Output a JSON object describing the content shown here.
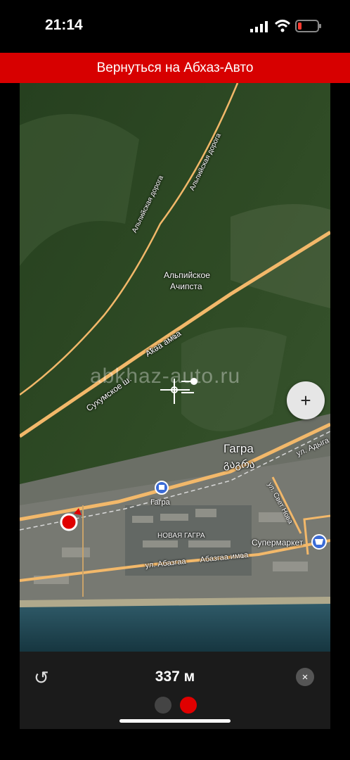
{
  "status_bar": {
    "time": "21:14"
  },
  "banner": {
    "label": "Вернуться на Абхаз-Авто"
  },
  "map": {
    "watermark": "abkhaz-auto.ru",
    "labels": {
      "alpine_road_1": "Альпийская дорога",
      "alpine_road_2": "Альпийская дорога",
      "alpiyskoe": "Альпийское",
      "achipsta": "Ачипста",
      "sukhumskoe": "Сухумское ш.",
      "akva_amca": "Аҟәа амҩа",
      "gagra_ru": "Гагра",
      "gagra_ge": "გაგრა",
      "ul_adyga": "ул. Адыга",
      "ul_svetnova": "ул. Свет Нова",
      "station": "Гагра",
      "novaya_gagra": "НОВАЯ ГАГРА",
      "supermarket": "Супермаркет",
      "ul_abazgaa": "ул. Абазгаа",
      "abazgaa_imca": "Абазгаа имҩа"
    },
    "zoom_in": "+"
  },
  "bottom_panel": {
    "distance": "337 м",
    "reset_icon": "↺",
    "close_icon": "×"
  },
  "colors": {
    "accent": "#d70000",
    "road": "#f2b86a"
  }
}
